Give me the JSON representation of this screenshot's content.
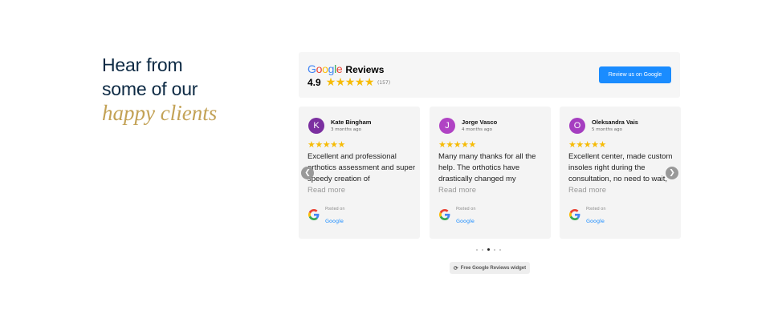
{
  "heading": {
    "line1": "Hear from",
    "line2": "some of our",
    "accent": "happy clients"
  },
  "widget": {
    "brand_word": "Google",
    "brand_suffix": "Reviews",
    "rating": "4.9",
    "stars": "★★★★★",
    "review_count": "(157)",
    "cta_label": "Review us on Google"
  },
  "reviews": [
    {
      "initial": "K",
      "avatar_color": "#7b2fa0",
      "name": "Kate Bingham",
      "time": "3 months ago",
      "stars": "★★★★★",
      "text": "Excellent and professional orthotics assessment and super speedy creation of",
      "more": "Read more",
      "posted_label": "Posted on",
      "source": "Google"
    },
    {
      "initial": "J",
      "avatar_color": "#b043c4",
      "name": "Jorge Vasco",
      "time": "4 months ago",
      "stars": "★★★★★",
      "text": "Many many thanks for all the help. The orthotics have drastically changed my",
      "more": "Read more",
      "posted_label": "Posted on",
      "source": "Google"
    },
    {
      "initial": "O",
      "avatar_color": "#a53ec0",
      "name": "Oleksandra Vais",
      "time": "5 months ago",
      "stars": "★★★★★",
      "text": "Excellent center, made custom insoles right during the consultation, no need to wait,",
      "more": "Read more",
      "posted_label": "Posted on",
      "source": "Google"
    }
  ],
  "carousel": {
    "dot_count": 5,
    "active_index": 2
  },
  "footer_badge": "Free Google Reviews widget",
  "icons": {
    "prev": "chevron-left-icon",
    "next": "chevron-right-icon",
    "google": "google-g-icon"
  },
  "colors": {
    "heading": "#0d2a44",
    "accent": "#c3a256",
    "button": "#1a8cff",
    "star": "#f6bb06"
  }
}
